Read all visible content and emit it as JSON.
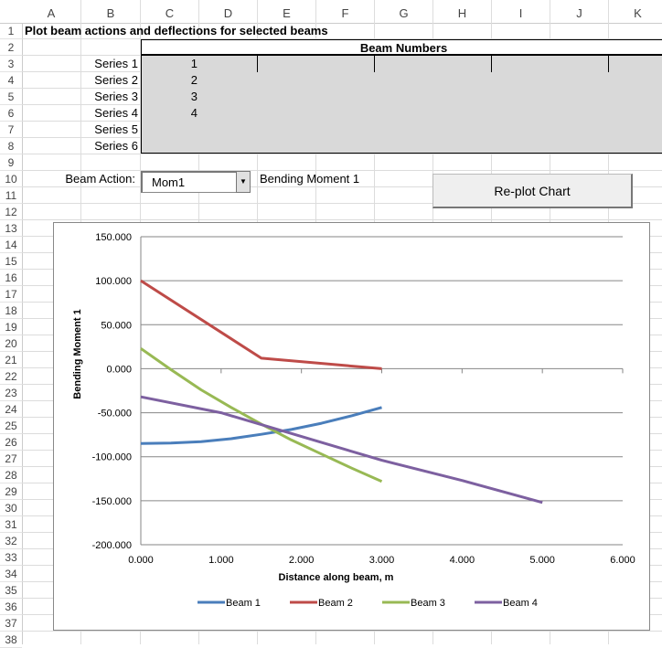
{
  "columns": [
    "A",
    "B",
    "C",
    "D",
    "E",
    "F",
    "G",
    "H",
    "I",
    "J",
    "K"
  ],
  "rows": [
    "1",
    "2",
    "3",
    "4",
    "5",
    "6",
    "7",
    "8",
    "9",
    "10",
    "11",
    "12",
    "13",
    "14",
    "15",
    "16",
    "17",
    "18",
    "19",
    "20",
    "21",
    "22",
    "23",
    "24",
    "25",
    "26",
    "27",
    "28",
    "29",
    "30",
    "31",
    "32",
    "33",
    "34",
    "35",
    "36",
    "37",
    "38"
  ],
  "sheet": {
    "title": "Plot beam actions and deflections for selected beams",
    "beam_numbers_header": "Beam Numbers",
    "series_labels": [
      "Series 1",
      "Series 2",
      "Series 3",
      "Series 4",
      "Series 5",
      "Series 6"
    ],
    "series_beams": [
      "1",
      "2",
      "3",
      "4",
      "",
      ""
    ],
    "beam_action_label": "Beam Action:",
    "beam_action_value": "Mom1",
    "beam_action_desc": "Bending Moment 1",
    "replot_button": "Re-plot Chart"
  },
  "chart_data": {
    "type": "line",
    "title": "",
    "xlabel": "Distance along beam, m",
    "ylabel": "Bending Moment 1",
    "xlim": [
      0,
      6
    ],
    "ylim": [
      -200,
      150
    ],
    "xticks": [
      "0.000",
      "1.000",
      "2.000",
      "3.000",
      "4.000",
      "5.000",
      "6.000"
    ],
    "yticks": [
      "150.000",
      "100.000",
      "50.000",
      "0.000",
      "-50.000",
      "-100.000",
      "-150.000",
      "-200.000"
    ],
    "grid": true,
    "legend": "bottom",
    "series": [
      {
        "name": "Beam 1",
        "color": "#4a7ebb",
        "x": [
          0,
          0.375,
          0.75,
          1.125,
          1.5,
          1.875,
          2.25,
          2.625,
          3
        ],
        "y": [
          -85,
          -84.5,
          -83,
          -79.5,
          -74.5,
          -69,
          -62,
          -53.5,
          -44
        ]
      },
      {
        "name": "Beam 2",
        "color": "#be4b48",
        "x": [
          0,
          1.5,
          3
        ],
        "y": [
          100,
          12,
          0
        ]
      },
      {
        "name": "Beam 3",
        "color": "#98b954",
        "x": [
          0,
          0.375,
          0.75,
          1.125,
          1.5,
          1.875,
          2.25,
          2.625,
          3
        ],
        "y": [
          23,
          -1,
          -24,
          -44,
          -63,
          -81,
          -97,
          -113,
          -128
        ]
      },
      {
        "name": "Beam 4",
        "color": "#7d60a0",
        "x": [
          0,
          1,
          2,
          3,
          4,
          5
        ],
        "y": [
          -32,
          -50,
          -77,
          -104,
          -127,
          -152
        ]
      }
    ]
  }
}
